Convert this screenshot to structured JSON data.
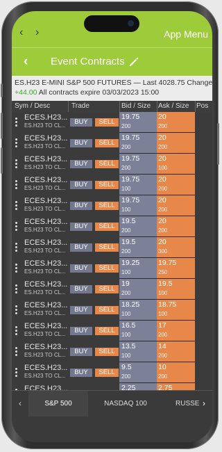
{
  "top_nav": {
    "back_icon": "chevron-left-icon",
    "forward_icon": "chevron-right-icon",
    "app_menu_label": "App Menu"
  },
  "header": {
    "title": "Event Contracts",
    "back_icon": "chevron-left-icon",
    "edit_icon": "pencil-icon"
  },
  "info": {
    "line1": "ES.H23 E-MINI S&P 500 FUTURES — Last 4028.75 Change",
    "change": "+44.00",
    "line2_rest": " All contracts expire 03/03/2023 15:00"
  },
  "columns": {
    "sym": "Sym / Desc",
    "trade": "Trade",
    "bid": "Bid / Size",
    "ask": "Ask / Size",
    "pos": "Pos"
  },
  "rows": [
    {
      "sym": "ECES.H23...",
      "desc": "ES.H23 TO CL...",
      "buy": "BUY",
      "sell": "SELL",
      "bid": "19.75",
      "bid_size": "200",
      "ask": "20",
      "ask_size": "200"
    },
    {
      "sym": "ECES.H23...",
      "desc": "ES.H23 TO CL...",
      "buy": "BUY",
      "sell": "SELL",
      "bid": "19.75",
      "bid_size": "200",
      "ask": "20",
      "ask_size": "200"
    },
    {
      "sym": "ECES.H23...",
      "desc": "ES.H23 TO CL...",
      "buy": "BUY",
      "sell": "SELL",
      "bid": "19.75",
      "bid_size": "200",
      "ask": "20",
      "ask_size": "100"
    },
    {
      "sym": "ECES.H23...",
      "desc": "ES.H23 TO CL...",
      "buy": "BUY",
      "sell": "SELL",
      "bid": "19.75",
      "bid_size": "100",
      "ask": "20",
      "ask_size": "200"
    },
    {
      "sym": "ECES.H23...",
      "desc": "ES.H23 TO CL...",
      "buy": "BUY",
      "sell": "SELL",
      "bid": "19.75",
      "bid_size": "100",
      "ask": "20",
      "ask_size": "200"
    },
    {
      "sym": "ECES.H23...",
      "desc": "ES.H23 TO CL...",
      "buy": "BUY",
      "sell": "SELL",
      "bid": "19.5",
      "bid_size": "200",
      "ask": "20",
      "ask_size": "200"
    },
    {
      "sym": "ECES.H23...",
      "desc": "ES.H23 TO CL...",
      "buy": "BUY",
      "sell": "SELL",
      "bid": "19.5",
      "bid_size": "200",
      "ask": "20",
      "ask_size": "300"
    },
    {
      "sym": "ECES.H23...",
      "desc": "ES.H23 TO CL...",
      "buy": "BUY",
      "sell": "SELL",
      "bid": "19.25",
      "bid_size": "100",
      "ask": "19.75",
      "ask_size": "250"
    },
    {
      "sym": "ECES.H23...",
      "desc": "ES.H23 TO CL...",
      "buy": "BUY",
      "sell": "SELL",
      "bid": "19",
      "bid_size": "200",
      "ask": "19.5",
      "ask_size": "100"
    },
    {
      "sym": "ECES.H23...",
      "desc": "ES.H23 TO CL...",
      "buy": "BUY",
      "sell": "SELL",
      "bid": "18.25",
      "bid_size": "100",
      "ask": "18.75",
      "ask_size": "100"
    },
    {
      "sym": "ECES.H23...",
      "desc": "ES.H23 TO CL...",
      "buy": "BUY",
      "sell": "SELL",
      "bid": "16.5",
      "bid_size": "100",
      "ask": "17",
      "ask_size": "200"
    },
    {
      "sym": "ECES.H23...",
      "desc": "ES.H23 TO CL...",
      "buy": "BUY",
      "sell": "SELL",
      "bid": "13.5",
      "bid_size": "100",
      "ask": "14",
      "ask_size": "200"
    },
    {
      "sym": "ECES.H23...",
      "desc": "ES.H23 TO CL...",
      "buy": "BUY",
      "sell": "SELL",
      "bid": "9.5",
      "bid_size": "200",
      "ask": "10",
      "ask_size": "200"
    },
    {
      "sym": "ECES.H23...",
      "desc": "",
      "buy": "",
      "sell": "",
      "bid": "2.25",
      "bid_size": "",
      "ask": "2.75",
      "ask_size": ""
    }
  ],
  "tabs": {
    "left_icon": "chevron-left-icon",
    "right_icon": "chevron-right-icon",
    "items": [
      "S&P 500",
      "NASDAQ 100",
      "RUSSE"
    ]
  },
  "colors": {
    "accent": "#9ecb3a",
    "bid": "#7c8198",
    "ask": "#e7884a",
    "change": "#3ea82c"
  }
}
